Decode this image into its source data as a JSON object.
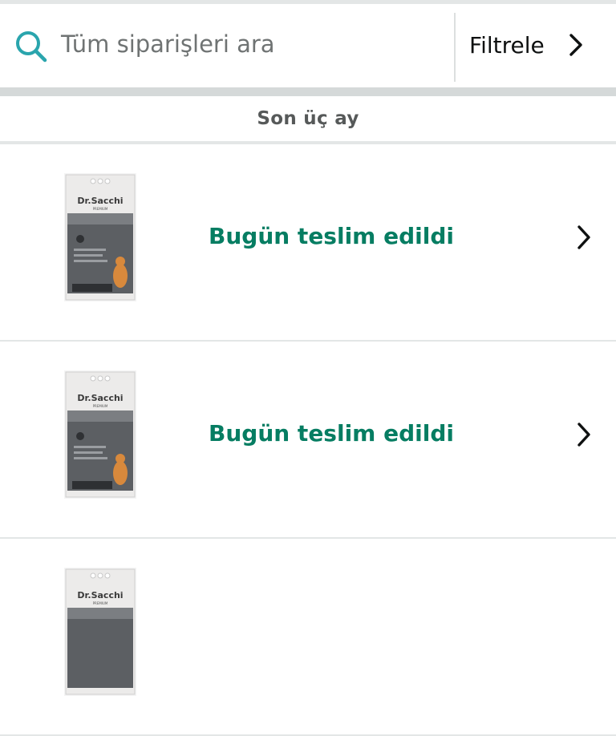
{
  "search": {
    "placeholder": "Tüm siparişleri ara",
    "icon": "search-icon",
    "icon_color": "#2aa5ad"
  },
  "filter": {
    "label": "Filtrele",
    "icon": "chevron-right-icon"
  },
  "section": {
    "title": "Son üç ay"
  },
  "orders": [
    {
      "status": "Bugün teslim edildi",
      "product_brand": "Dr.Sacchi",
      "product_sub": "PREMIUM",
      "status_color": "#067d62"
    },
    {
      "status": "Bugün teslim edildi",
      "product_brand": "Dr.Sacchi",
      "product_sub": "PREMIUM",
      "status_color": "#067d62"
    },
    {
      "status": "",
      "product_brand": "Dr.Sacchi",
      "product_sub": "PREMIUM",
      "status_color": "#067d62"
    }
  ]
}
